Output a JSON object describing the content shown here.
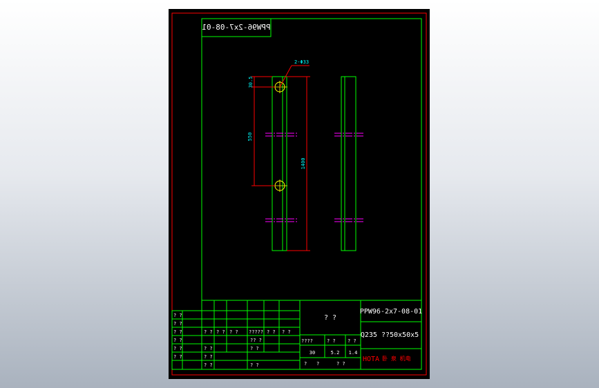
{
  "drawing": {
    "stamp_mirrored": "PPW96-2x7-08-01",
    "dims": {
      "hole_callout": "2-Φ33",
      "top_offset": "30.5",
      "hole_spacing": "550",
      "overall_length": "1400"
    },
    "title_block": {
      "drawing_no": "PPW96-2x7-08-01",
      "part_name": "? ?",
      "material_spec": "Q235 ??50x50x5",
      "company": "HOTA",
      "company_cn": "卧 泉 机电",
      "rev_left": [
        "? ?",
        "? ?",
        "? ?",
        "? ?",
        "? ?",
        "? ?"
      ],
      "grid_r1": [
        "? ?",
        "? ?",
        "? ?",
        "?????",
        "? ?",
        "? ?"
      ],
      "grid_r2": [
        "? ?",
        "? ?"
      ],
      "grid_r3": [
        "? ?",
        "? ?",
        "? ?"
      ],
      "grid_label_2011": "?? ?",
      "scale_header": [
        "????",
        "? ?",
        "? ?"
      ],
      "scale_values": [
        "30",
        "5.2",
        "1.4"
      ],
      "bottom_marks": [
        "?",
        "?",
        "? ?"
      ]
    },
    "colors": {
      "border": "#ff0000",
      "part_line": "#00ff00",
      "dimension": "#ff0000",
      "text": "#00ffff",
      "centerline": "#ff00ff",
      "hole": "#ffff00",
      "table": "#00ff00",
      "table_text": "#ffffff"
    }
  }
}
